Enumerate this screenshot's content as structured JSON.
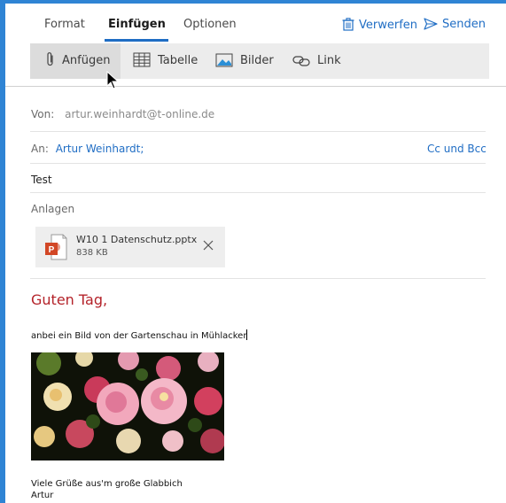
{
  "tabs": {
    "format": "Format",
    "insert": "Einfügen",
    "options": "Optionen"
  },
  "actions": {
    "discard": "Verwerfen",
    "send": "Senden"
  },
  "ribbon": {
    "attach": "Anfügen",
    "table": "Tabelle",
    "pictures": "Bilder",
    "link": "Link"
  },
  "mail": {
    "from_label": "Von:",
    "from_value": "artur.weinhardt@t-online.de",
    "to_label": "An:",
    "to_value": "Artur Weinhardt;",
    "cc_bcc": "Cc und Bcc",
    "subject": "Test",
    "attachments_label": "Anlagen"
  },
  "attachment": {
    "name": "W10 1 Datenschutz.pptx",
    "size": "838 KB"
  },
  "body": {
    "greeting": "Guten Tag,",
    "line1": "anbei ein Bild von der Gartenschau in Mühlacker",
    "closing1": "Viele Grüße aus'm große Glabbich",
    "closing2": "Artur"
  },
  "colors": {
    "accent": "#1f6dc4",
    "greeting": "#b4232a",
    "window_border": "#2f84d4"
  }
}
